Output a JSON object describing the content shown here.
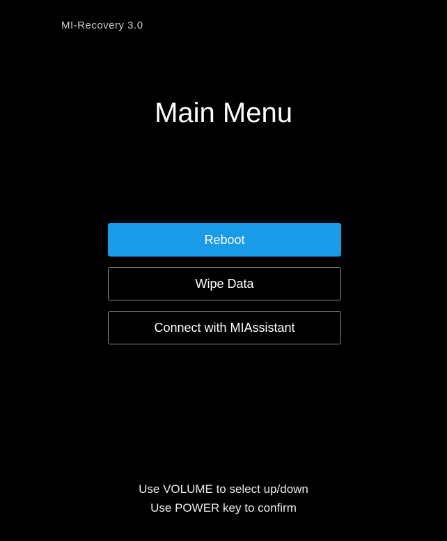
{
  "header": {
    "version": "MI-Recovery 3.0"
  },
  "title": "Main Menu",
  "menu": {
    "items": [
      {
        "label": "Reboot",
        "selected": true
      },
      {
        "label": "Wipe Data",
        "selected": false
      },
      {
        "label": "Connect with MIAssistant",
        "selected": false
      }
    ]
  },
  "footer": {
    "line1": "Use VOLUME to select up/down",
    "line2": "Use POWER key to confirm"
  },
  "colors": {
    "accent": "#1a9be8",
    "background": "#000000",
    "text": "#ffffff"
  }
}
